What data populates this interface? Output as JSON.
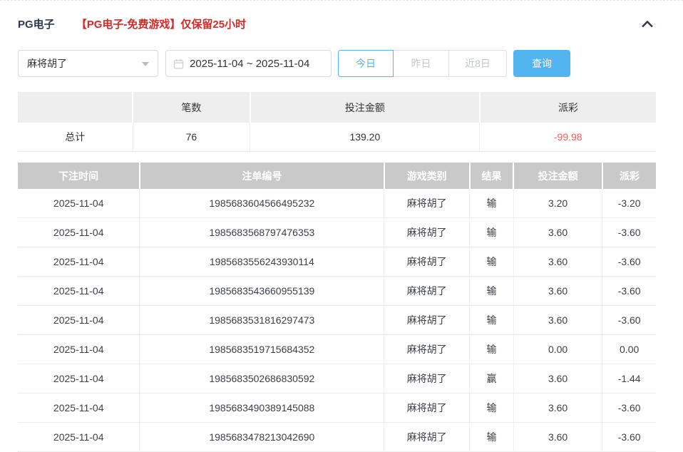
{
  "header": {
    "title": "PG电子",
    "notice": "【PG电子-免费游戏】仅保留25小时"
  },
  "icons": {
    "collapse": "chevron-up-icon",
    "game_select": "caret-down-icon",
    "date_range": "calendar-icon"
  },
  "filters": {
    "game_select_value": "麻将胡了",
    "date_range_value": "2025-11-04 ~ 2025-11-04",
    "quick_buttons": [
      {
        "label": "今日",
        "active": true
      },
      {
        "label": "昨日",
        "active": false
      },
      {
        "label": "近8日",
        "active": false
      }
    ],
    "query_label": "查询"
  },
  "summary": {
    "columns": [
      "",
      "笔数",
      "投注金额",
      "派彩"
    ],
    "row_label": "总计",
    "count": "76",
    "bet_amount": "139.20",
    "payout": "-99.98"
  },
  "detail": {
    "columns": [
      "下注时间",
      "注单编号",
      "游戏类别",
      "结果",
      "投注金额",
      "派彩"
    ],
    "rows": [
      {
        "date": "2025-11-04",
        "order_no": "1985683604566495232",
        "game": "麻将胡了",
        "result": "输",
        "bet": "3.20",
        "payout": "-3.20"
      },
      {
        "date": "2025-11-04",
        "order_no": "1985683568797476353",
        "game": "麻将胡了",
        "result": "输",
        "bet": "3.60",
        "payout": "-3.60"
      },
      {
        "date": "2025-11-04",
        "order_no": "1985683556243930114",
        "game": "麻将胡了",
        "result": "输",
        "bet": "3.60",
        "payout": "-3.60"
      },
      {
        "date": "2025-11-04",
        "order_no": "1985683543660955139",
        "game": "麻将胡了",
        "result": "输",
        "bet": "3.60",
        "payout": "-3.60"
      },
      {
        "date": "2025-11-04",
        "order_no": "1985683531816297473",
        "game": "麻将胡了",
        "result": "输",
        "bet": "3.60",
        "payout": "-3.60"
      },
      {
        "date": "2025-11-04",
        "order_no": "1985683519715684352",
        "game": "麻将胡了",
        "result": "输",
        "bet": "0.00",
        "payout": "0.00"
      },
      {
        "date": "2025-11-04",
        "order_no": "1985683502686830592",
        "game": "麻将胡了",
        "result": "赢",
        "bet": "3.60",
        "payout": "-1.44"
      },
      {
        "date": "2025-11-04",
        "order_no": "1985683490389145088",
        "game": "麻将胡了",
        "result": "输",
        "bet": "3.60",
        "payout": "-3.60"
      },
      {
        "date": "2025-11-04",
        "order_no": "1985683478213042690",
        "game": "麻将胡了",
        "result": "输",
        "bet": "3.60",
        "payout": "-3.60"
      }
    ]
  },
  "colors": {
    "accent_blue": "#53b5f0",
    "negative_red": "#f15c5c",
    "notice_red": "#d12b2b",
    "title_navy": "#2e3a4e",
    "detail_header_gray": "#c9c9c9",
    "summary_header_gray": "#eeeeee"
  }
}
